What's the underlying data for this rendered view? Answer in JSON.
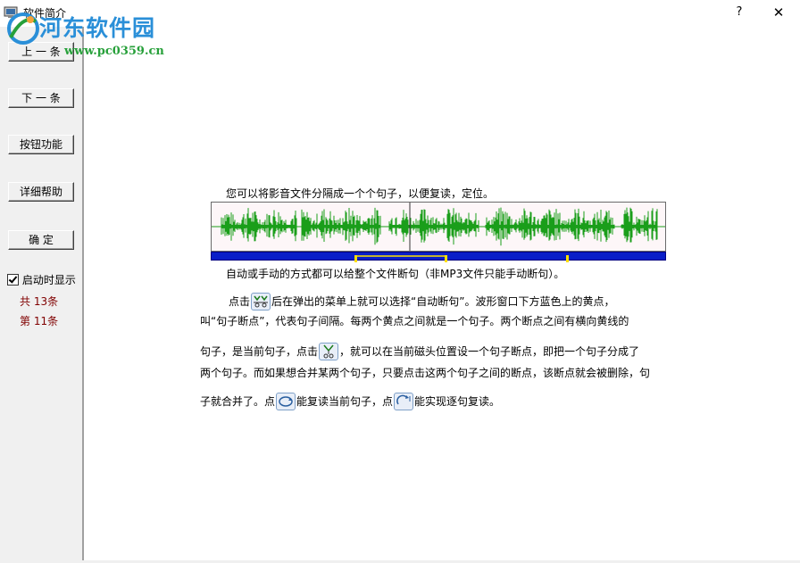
{
  "window": {
    "title": "软件简介",
    "help_label": "?",
    "close_label": "✕"
  },
  "watermark": {
    "name": "河东软件园",
    "url": "www.pc0359.cn"
  },
  "sidebar": {
    "buttons": {
      "prev": "上 一 条",
      "next": "下 一 条",
      "features": "按钮功能",
      "help": "详细帮助",
      "ok": "确  定"
    },
    "startup_label": "启动时显示",
    "startup_checked": true,
    "total": "共 13条",
    "current": "第 11条"
  },
  "content": {
    "line1": "您可以将影音文件分隔成一个个句子，以便复读，定位。",
    "line2": "自动或手动的方式都可以给整个文件断句（非MP3文件只能手动断句）。",
    "p1a": "点击",
    "p1b": "后在弹出的菜单上就可以选择“自动断句”。波形窗口下方蓝色上的黄点，",
    "p2": "叫“句子断点”，代表句子间隔。每两个黄点之间就是一个句子。两个断点之间有横向黄线的",
    "p3a": "句子，是当前句子，点击",
    "p3b": "，就可以在当前磁头位置设一个句子断点，即把一个句子分成了",
    "p4": "两个句子。而如果想合并某两个句子，只要点击这两个句子之间的断点，该断点就会被删除，句",
    "p5a": "子就合并了。点",
    "p5b": "能复读当前句子，点",
    "p5c": "能实现逐句复读。"
  },
  "colors": {
    "waveform": "#1a9e1a",
    "sentence_bar": "#0a1ec8",
    "breakpoint": "#ffe000",
    "count_text": "#800000",
    "watermark_blue": "#2a8fd8",
    "watermark_green": "#27a03a"
  }
}
